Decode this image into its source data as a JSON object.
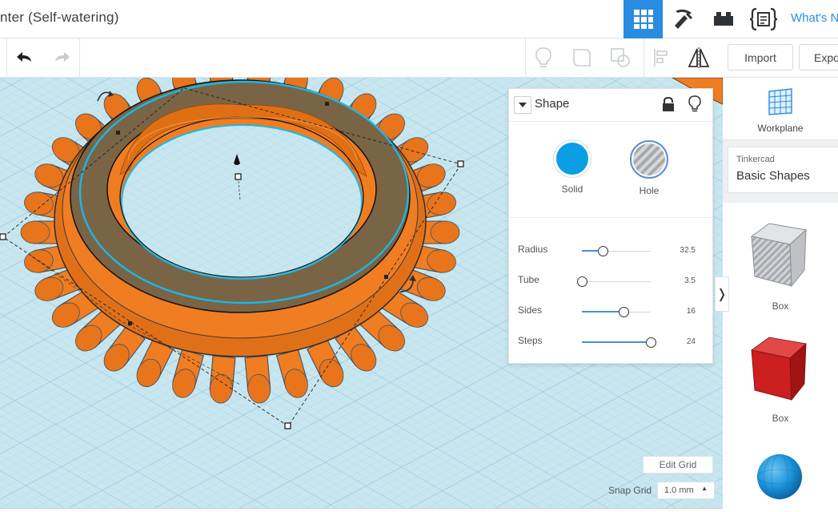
{
  "app": {
    "document_title": "nter (Self-watering)",
    "whats_new_label": "What's N"
  },
  "topbar": {
    "buttons": [
      {
        "name": "3d-view",
        "icon": "grid-icon",
        "active": true
      },
      {
        "name": "blocks",
        "icon": "pickaxe-icon",
        "active": false
      },
      {
        "name": "bricks",
        "icon": "brick-icon",
        "active": false
      },
      {
        "name": "codeblocks",
        "icon": "code-braces-icon",
        "active": false
      }
    ]
  },
  "toolbar": {
    "undo_icon": "undo-icon",
    "redo_icon": "redo-icon",
    "tools": [
      "lightbulb-icon",
      "group-icon",
      "ungroup-icon",
      "align-icon",
      "mirror-icon"
    ],
    "import_label": "Import",
    "export_label": "Expo"
  },
  "inspector": {
    "title": "Shape",
    "modes": {
      "solid_label": "Solid",
      "hole_label": "Hole",
      "selected": "Solid"
    },
    "solid_color": "#0a9ee4",
    "params": [
      {
        "label": "Radius",
        "value": "32.5",
        "fraction": 0.3
      },
      {
        "label": "Tube",
        "value": "3.5",
        "fraction": 0.0
      },
      {
        "label": "Sides",
        "value": "16",
        "fraction": 0.61
      },
      {
        "label": "Steps",
        "value": "24",
        "fraction": 1.0
      }
    ]
  },
  "right_panel": {
    "workplane_label": "Workplane",
    "library_source": "Tinkercad",
    "library_name": "Basic Shapes",
    "shapes": [
      {
        "label": "Box",
        "style": "hole",
        "icon": "box-hole-icon"
      },
      {
        "label": "Box",
        "style": "solid",
        "color": "#cc1f1f",
        "icon": "box-icon"
      },
      {
        "label": "",
        "style": "solid",
        "color": "#1a8fd6",
        "icon": "sphere-icon"
      }
    ]
  },
  "canvas": {
    "edit_grid_label": "Edit Grid",
    "snap_grid_label": "Snap Grid",
    "snap_grid_value": "1.0 mm",
    "object_color": "#f07d22",
    "selection_color": "#19b8e6",
    "grid_color": "#c4e4ee"
  }
}
